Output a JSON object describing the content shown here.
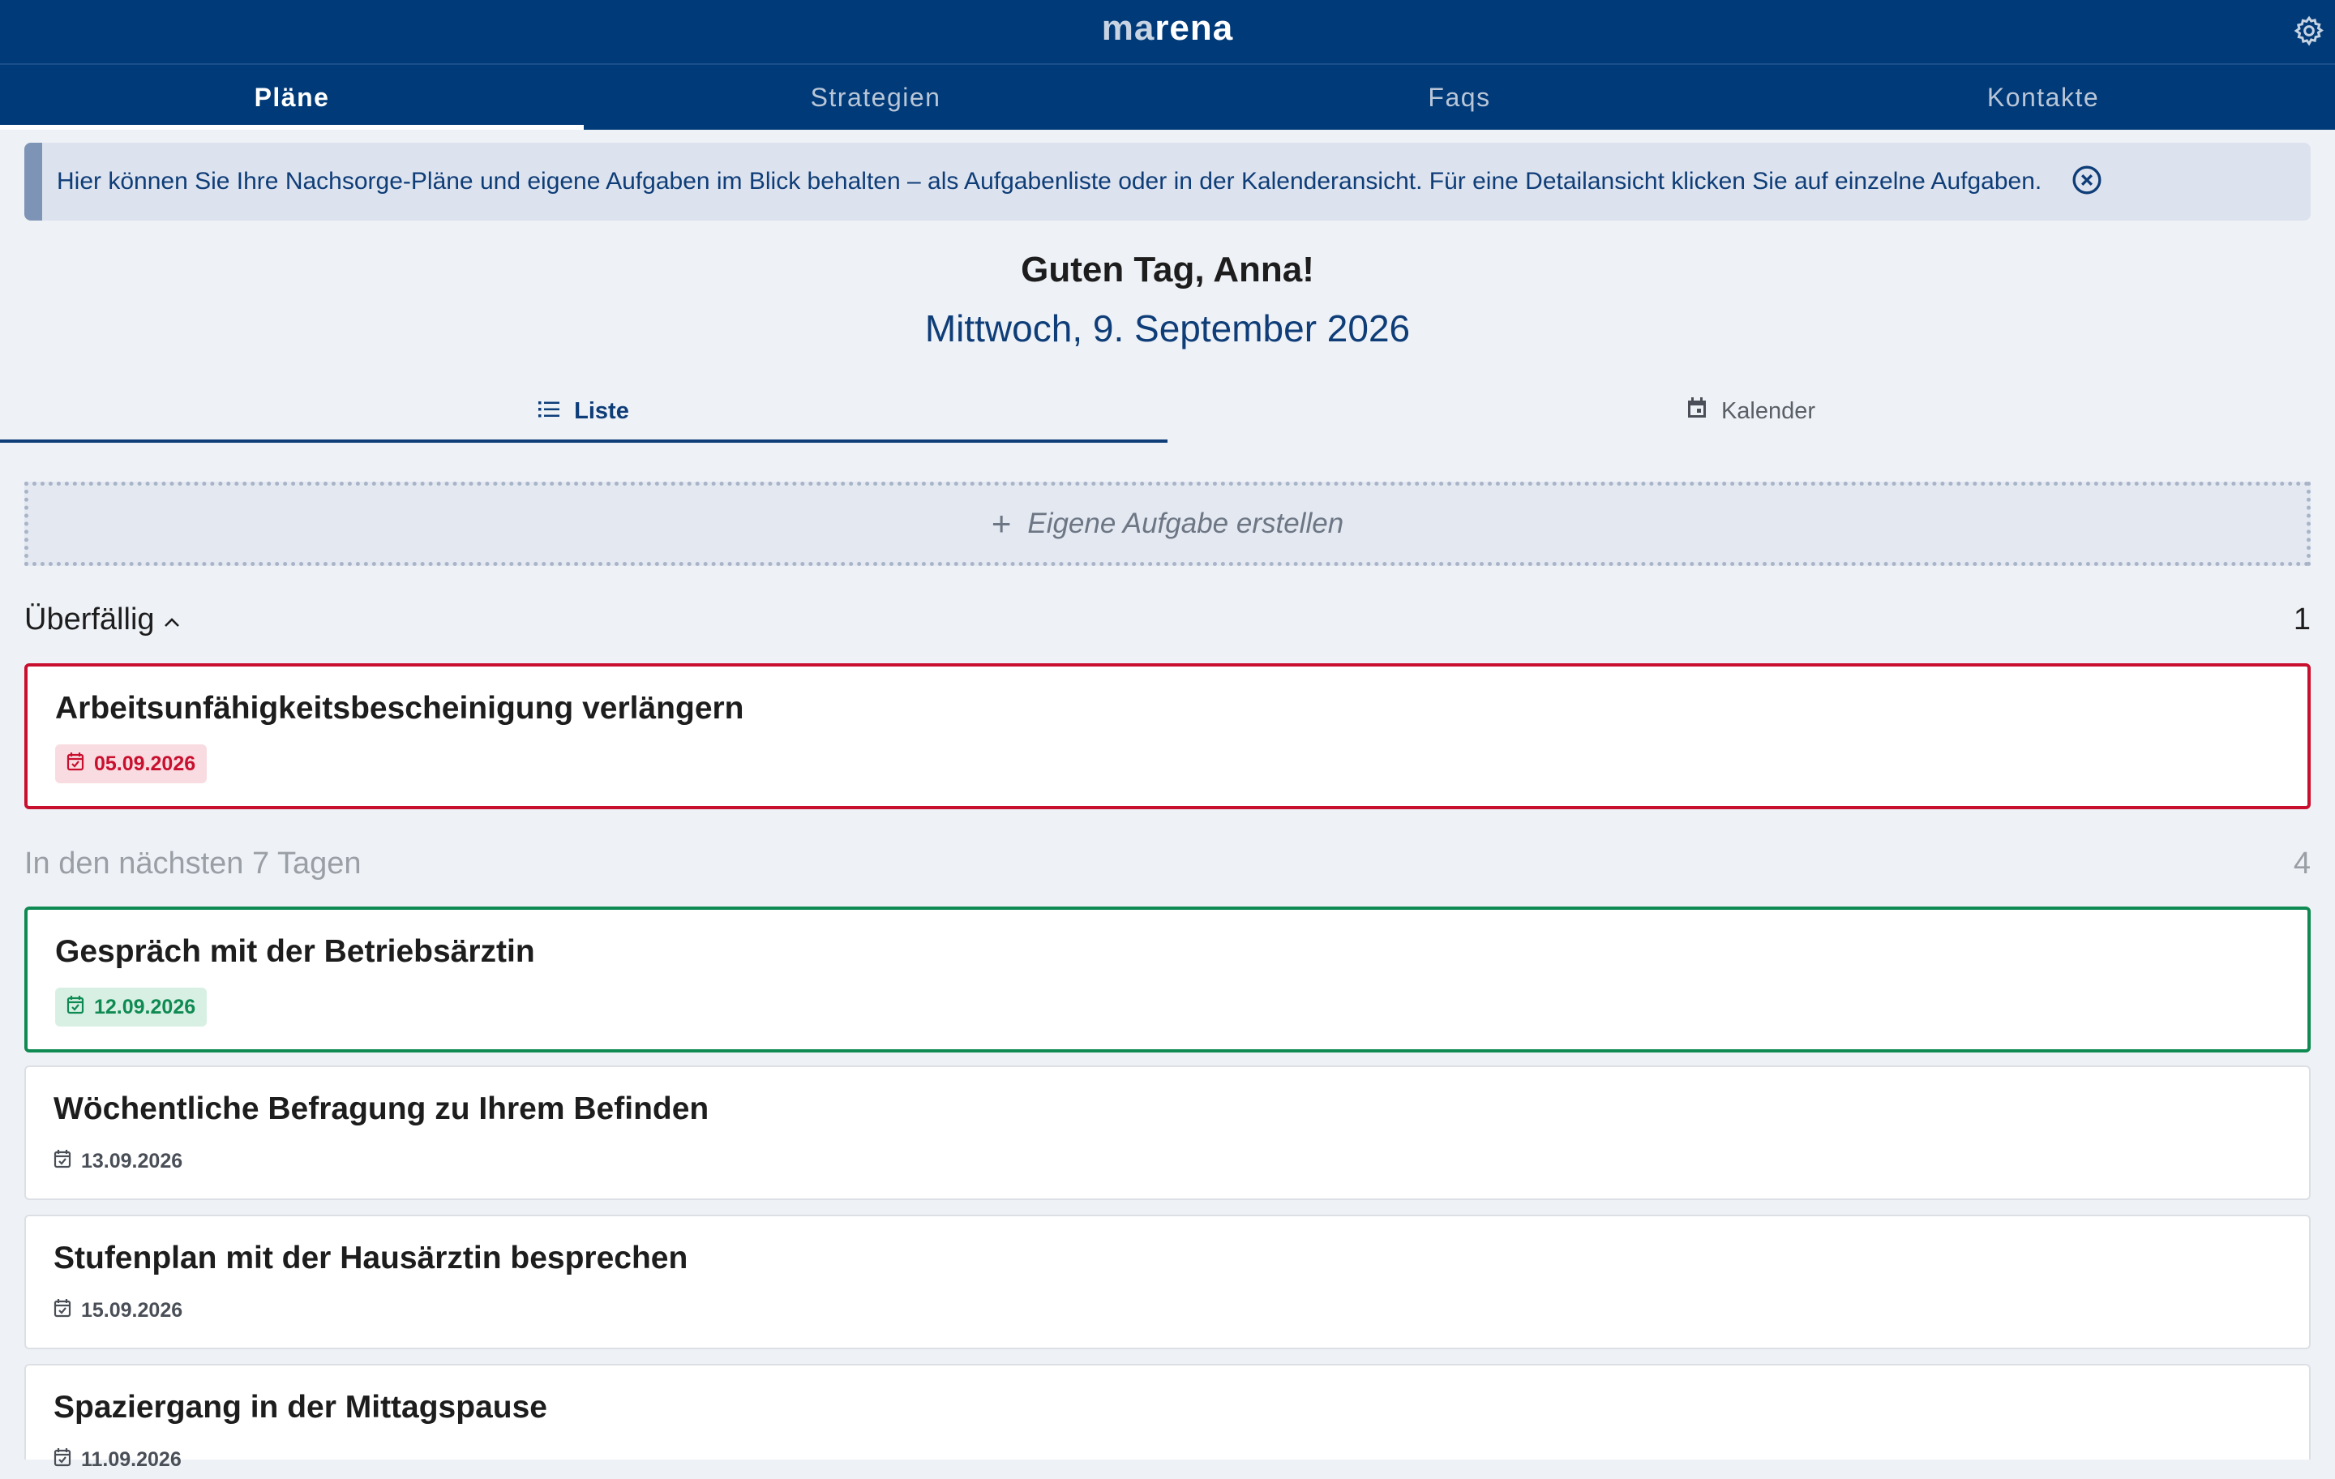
{
  "app": {
    "logo_prefix": "ma",
    "logo_suffix": "rena"
  },
  "nav": {
    "tabs": [
      {
        "label": "Pläne",
        "active": true
      },
      {
        "label": "Strategien",
        "active": false
      },
      {
        "label": "Faqs",
        "active": false
      },
      {
        "label": "Kontakte",
        "active": false
      }
    ]
  },
  "banner": {
    "text": "Hier können Sie Ihre Nachsorge-Pläne und eigene Aufgaben im Blick behalten – als Aufgabenliste oder in der Kalenderansicht. Für eine Detailansicht klicken Sie auf einzelne Aufgaben."
  },
  "greeting": {
    "hello": "Guten Tag, Anna!",
    "date": "Mittwoch, 9. September 2026"
  },
  "view_tabs": {
    "list": "Liste",
    "calendar": "Kalender",
    "active": "list"
  },
  "create_task": {
    "label": "Eigene Aufgabe erstellen"
  },
  "sections": {
    "overdue": {
      "label": "Überfällig",
      "count": "1"
    },
    "next7": {
      "label": "In den nächsten 7 Tagen",
      "count": "4"
    }
  },
  "tasks": {
    "overdue": [
      {
        "title": "Arbeitsunfähigkeitsbescheinigung verlängern",
        "date": "05.09.2026"
      }
    ],
    "next7": [
      {
        "title": "Gespräch mit der Betriebsärztin",
        "date": "12.09.2026"
      },
      {
        "title": "Wöchentliche Befragung zu Ihrem Befinden",
        "date": "13.09.2026"
      },
      {
        "title": "Stufenplan mit der Hausärztin besprechen",
        "date": "15.09.2026"
      },
      {
        "title": "Spaziergang in der Mittagspause",
        "date": "11.09.2026"
      }
    ]
  },
  "colors": {
    "header": "#003a78",
    "overdue": "#c8102e",
    "soon": "#0f8a52",
    "accent": "#0e3d78"
  },
  "icons": {
    "settings": "gear-icon",
    "close": "close-circle-icon",
    "list": "list-icon",
    "calendar": "calendar-icon",
    "plus": "plus-icon",
    "chevron": "chevron-up-icon",
    "date": "calendar-check-icon"
  }
}
